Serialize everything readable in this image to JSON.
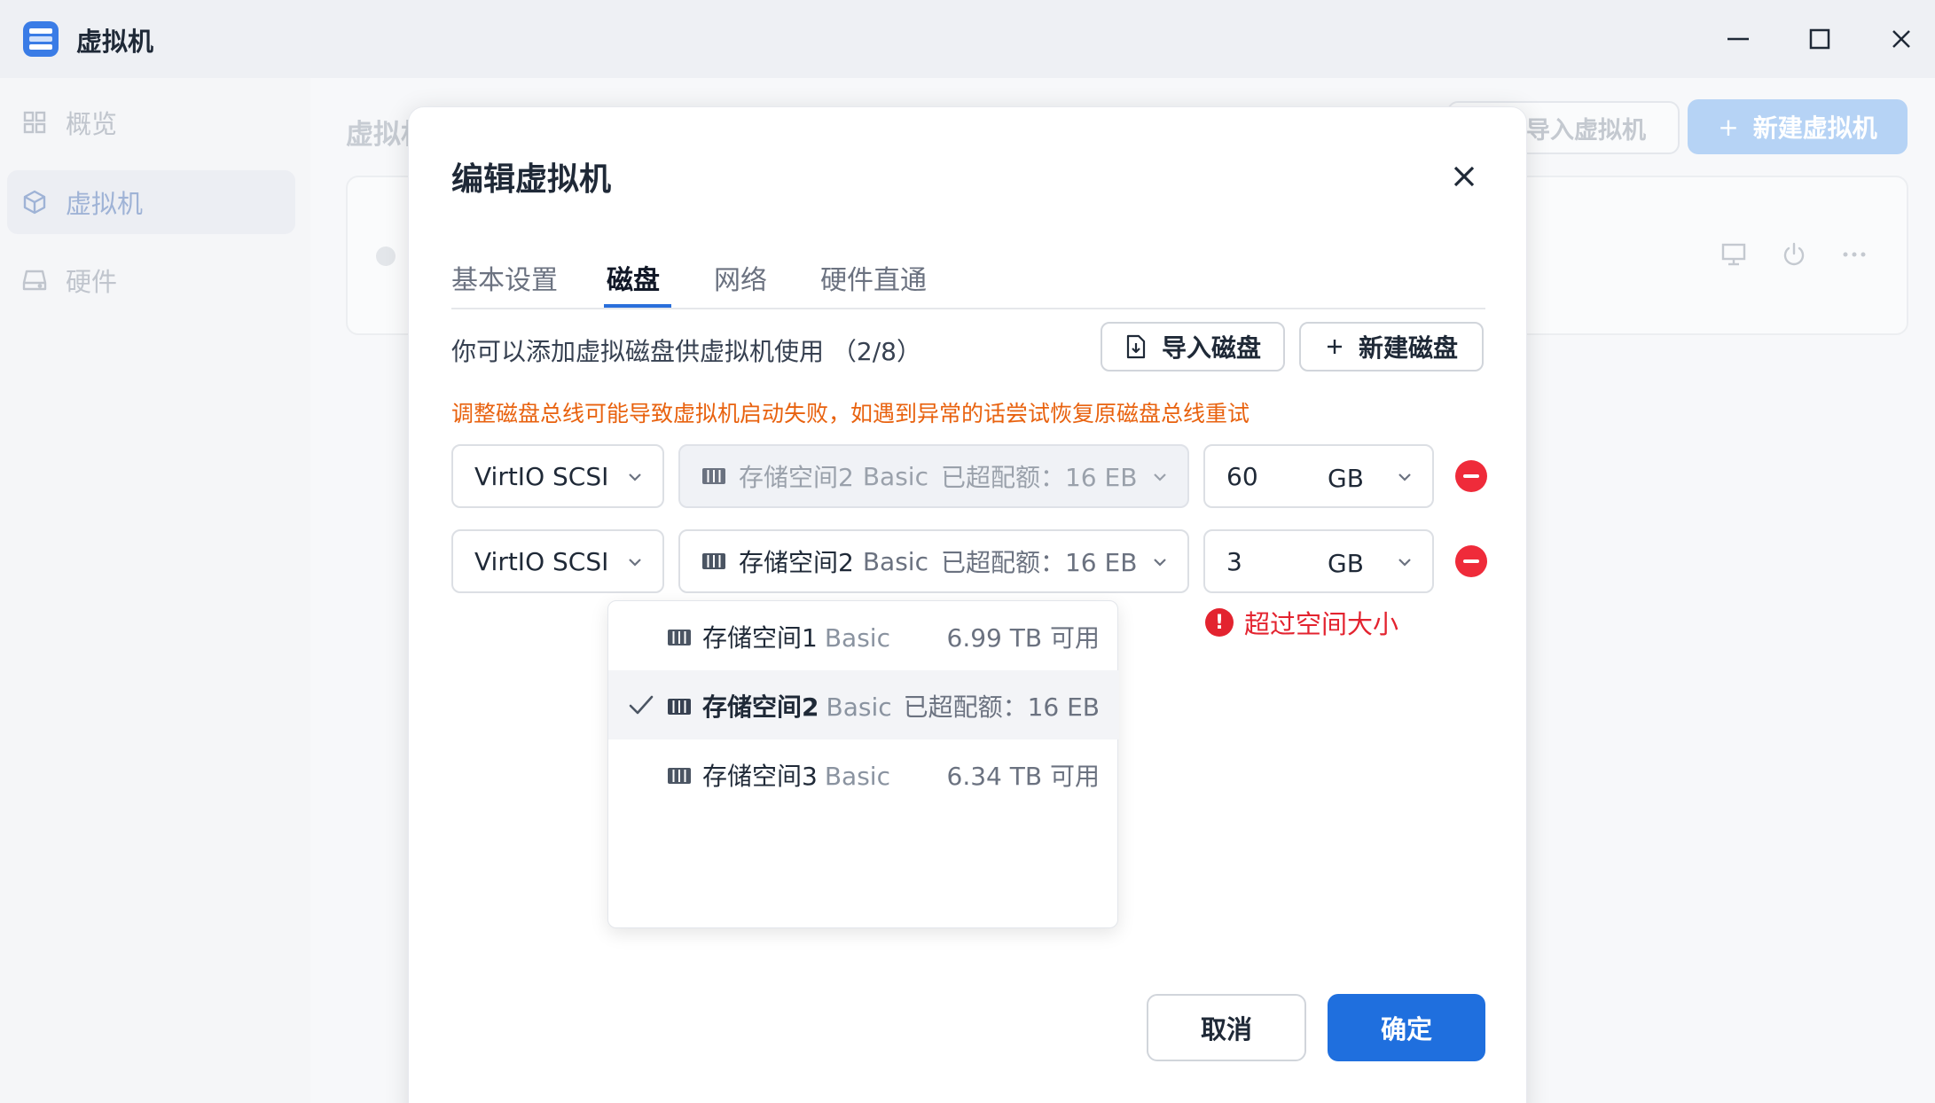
{
  "window": {
    "title": "虚拟机",
    "controls": [
      "minimize-icon",
      "maximize-icon",
      "close-icon"
    ]
  },
  "sidebar": {
    "items": [
      {
        "label": "概览",
        "icon": "grid-icon",
        "active": false
      },
      {
        "label": "虚拟机",
        "icon": "cube-icon",
        "active": true
      },
      {
        "label": "硬件",
        "icon": "drive-icon",
        "active": false
      }
    ]
  },
  "background": {
    "title": "虚拟机",
    "import_vm_label": "导入虚拟机",
    "new_vm_label": "新建虚拟机"
  },
  "modal": {
    "title": "编辑虚拟机",
    "tabs": [
      {
        "label": "基本设置",
        "active": false
      },
      {
        "label": "磁盘",
        "active": true
      },
      {
        "label": "网络",
        "active": false
      },
      {
        "label": "硬件直通",
        "active": false
      }
    ],
    "disk_description": "你可以添加虚拟磁盘供虚拟机使用 （2/8）",
    "import_disk_label": "导入磁盘",
    "new_disk_label": "新建磁盘",
    "warning": "调整磁盘总线可能导致虚拟机启动失败，如遇到异常的话尝试恢复原磁盘总线重试",
    "disks": [
      {
        "bus": "VirtIO SCSI",
        "pool_name": "存储空间2",
        "pool_type": "Basic",
        "pool_status": "已超配额：16 EB",
        "size": "60",
        "unit": "GB",
        "pool_disabled": true
      },
      {
        "bus": "VirtIO SCSI",
        "pool_name": "存储空间2",
        "pool_type": "Basic",
        "pool_status": "已超配额：16 EB",
        "size": "3",
        "unit": "GB",
        "pool_disabled": false
      }
    ],
    "error": "超过空间大小",
    "pool_options": [
      {
        "name": "存储空间1",
        "type": "Basic",
        "capacity": "6.99 TB 可用",
        "selected": false
      },
      {
        "name": "存储空间2",
        "type": "Basic",
        "capacity": "已超配额：16 EB",
        "selected": true
      },
      {
        "name": "存储空间3",
        "type": "Basic",
        "capacity": "6.34 TB 可用",
        "selected": false
      }
    ],
    "cancel_label": "取消",
    "ok_label": "确定"
  },
  "colors": {
    "accent": "#1f6fde",
    "warning": "#e8620f",
    "error": "#e3232f"
  }
}
